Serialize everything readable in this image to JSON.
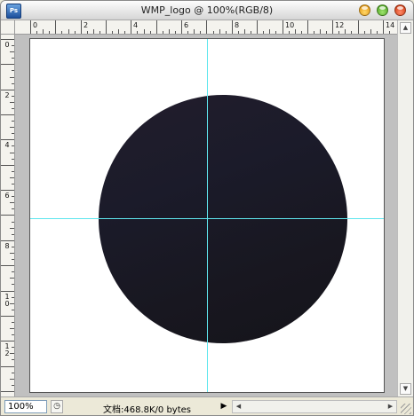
{
  "window": {
    "title": "WMP_logo @ 100%(RGB/8)",
    "app_icon_text": "Ps",
    "controls": [
      "minimize",
      "maximize",
      "close"
    ]
  },
  "rulers": {
    "horizontal_labels": [
      "0",
      "2",
      "4",
      "6",
      "8",
      "10",
      "12",
      "14"
    ],
    "vertical_labels": [
      "0",
      "2",
      "4",
      "6",
      "8",
      "1\n0",
      "1\n2"
    ]
  },
  "canvas": {
    "background": "#ffffff",
    "shape": "circle",
    "shape_colors": [
      "#221d2c",
      "#15141a"
    ],
    "guide_color": "#5fe6ee"
  },
  "status": {
    "zoom": "100%",
    "doc_info": "文档:468.8K/0 bytes"
  }
}
